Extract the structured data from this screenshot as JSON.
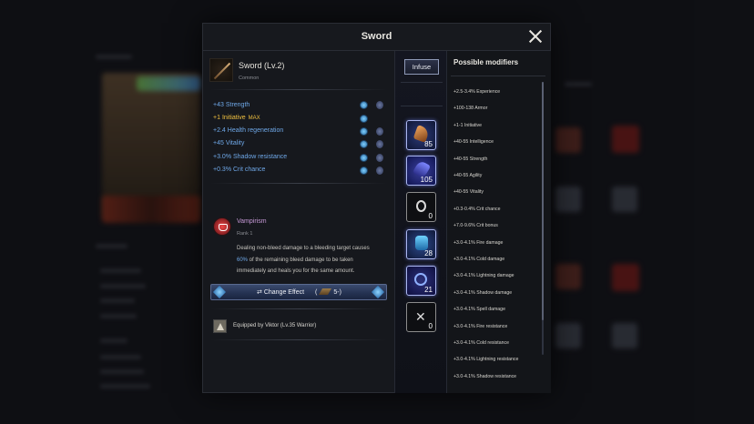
{
  "modal": {
    "title": "Sword"
  },
  "item": {
    "name": "Sword (Lv.2)",
    "rarity": "Common"
  },
  "stats": [
    {
      "value": "+43",
      "name": "Strength",
      "max": ""
    },
    {
      "value": "+1",
      "name": "Initiative",
      "max": "MAX"
    },
    {
      "value": "+2.4",
      "name": "Health regeneration",
      "max": ""
    },
    {
      "value": "+45",
      "name": "Vitality",
      "max": ""
    },
    {
      "value": "+3.0%",
      "name": "Shadow resistance",
      "max": ""
    },
    {
      "value": "+0.3%",
      "name": "Crit chance",
      "max": ""
    }
  ],
  "effect": {
    "name": "Vampirism",
    "rank": "Rank 1",
    "desc_1": "Dealing non-bleed damage to a bleeding target causes",
    "desc_pct": "60%",
    "desc_2": " of the remaining bleed damage to be taken",
    "desc_3": "immediately and heals you for the same amount."
  },
  "change_effect": {
    "label": "Change Effect",
    "cost_open": "(",
    "cost": "5",
    "cost_close": ")"
  },
  "equipped_by": "Equipped by Viktor (Lv.35 Warrior)",
  "infuse_label": "Infuse",
  "slots": [
    {
      "icon": "flame-rune-icon",
      "count": "85"
    },
    {
      "icon": "void-crystal-icon",
      "count": "105"
    },
    {
      "icon": "ring-rune-icon",
      "count": "0"
    },
    {
      "icon": "ice-crystal-icon",
      "count": "28"
    },
    {
      "icon": "spiral-rune-icon",
      "count": "21"
    },
    {
      "icon": "cross-rune-icon",
      "count": "0"
    }
  ],
  "modifiers": {
    "title": "Possible modifiers",
    "items": [
      "+2.5-3.4% Experience",
      "+100-138 Armor",
      "+1-1 Initiative",
      "+40-55 Intelligence",
      "+40-55 Strength",
      "+40-55 Agility",
      "+40-55 Vitality",
      "+0.3-0.4% Crit chance",
      "+7.0-9.6% Crit bonus",
      "+3.0-4.1% Fire damage",
      "+3.0-4.1% Cold damage",
      "+3.0-4.1% Lightning damage",
      "+3.0-4.1% Shadow damage",
      "+3.0-4.1% Spell damage",
      "+3.0-4.1% Fire resistance",
      "+3.0-4.1% Cold resistance",
      "+3.0-4.1% Lightning resistance",
      "+3.0-4.1% Shadow resistance"
    ]
  },
  "colors": {
    "stat_blue": "#6fa8e8",
    "highlight_gold": "#f0c040",
    "effect_purple": "#c89ad8"
  }
}
